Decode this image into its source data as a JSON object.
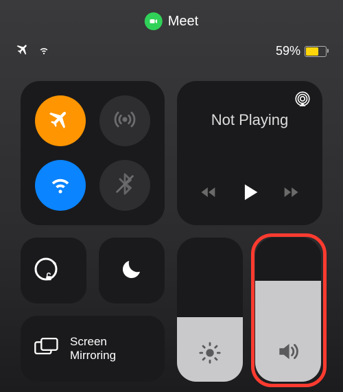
{
  "pill": {
    "app_name": "Meet"
  },
  "status": {
    "battery_percent": "59%",
    "battery_level": 0.59,
    "low_power": true,
    "airplane": true,
    "wifi": true
  },
  "connectivity": {
    "airplane": {
      "on": true
    },
    "cellular": {
      "on": false
    },
    "wifi": {
      "on": true
    },
    "bluetooth": {
      "on": false
    }
  },
  "media": {
    "title": "Not Playing"
  },
  "tiles": {
    "rotation_lock": true,
    "dnd": true
  },
  "mirror": {
    "label": "Screen Mirroring"
  },
  "sliders": {
    "brightness": {
      "level": 0.45
    },
    "volume": {
      "level": 0.7,
      "highlighted": true
    }
  }
}
